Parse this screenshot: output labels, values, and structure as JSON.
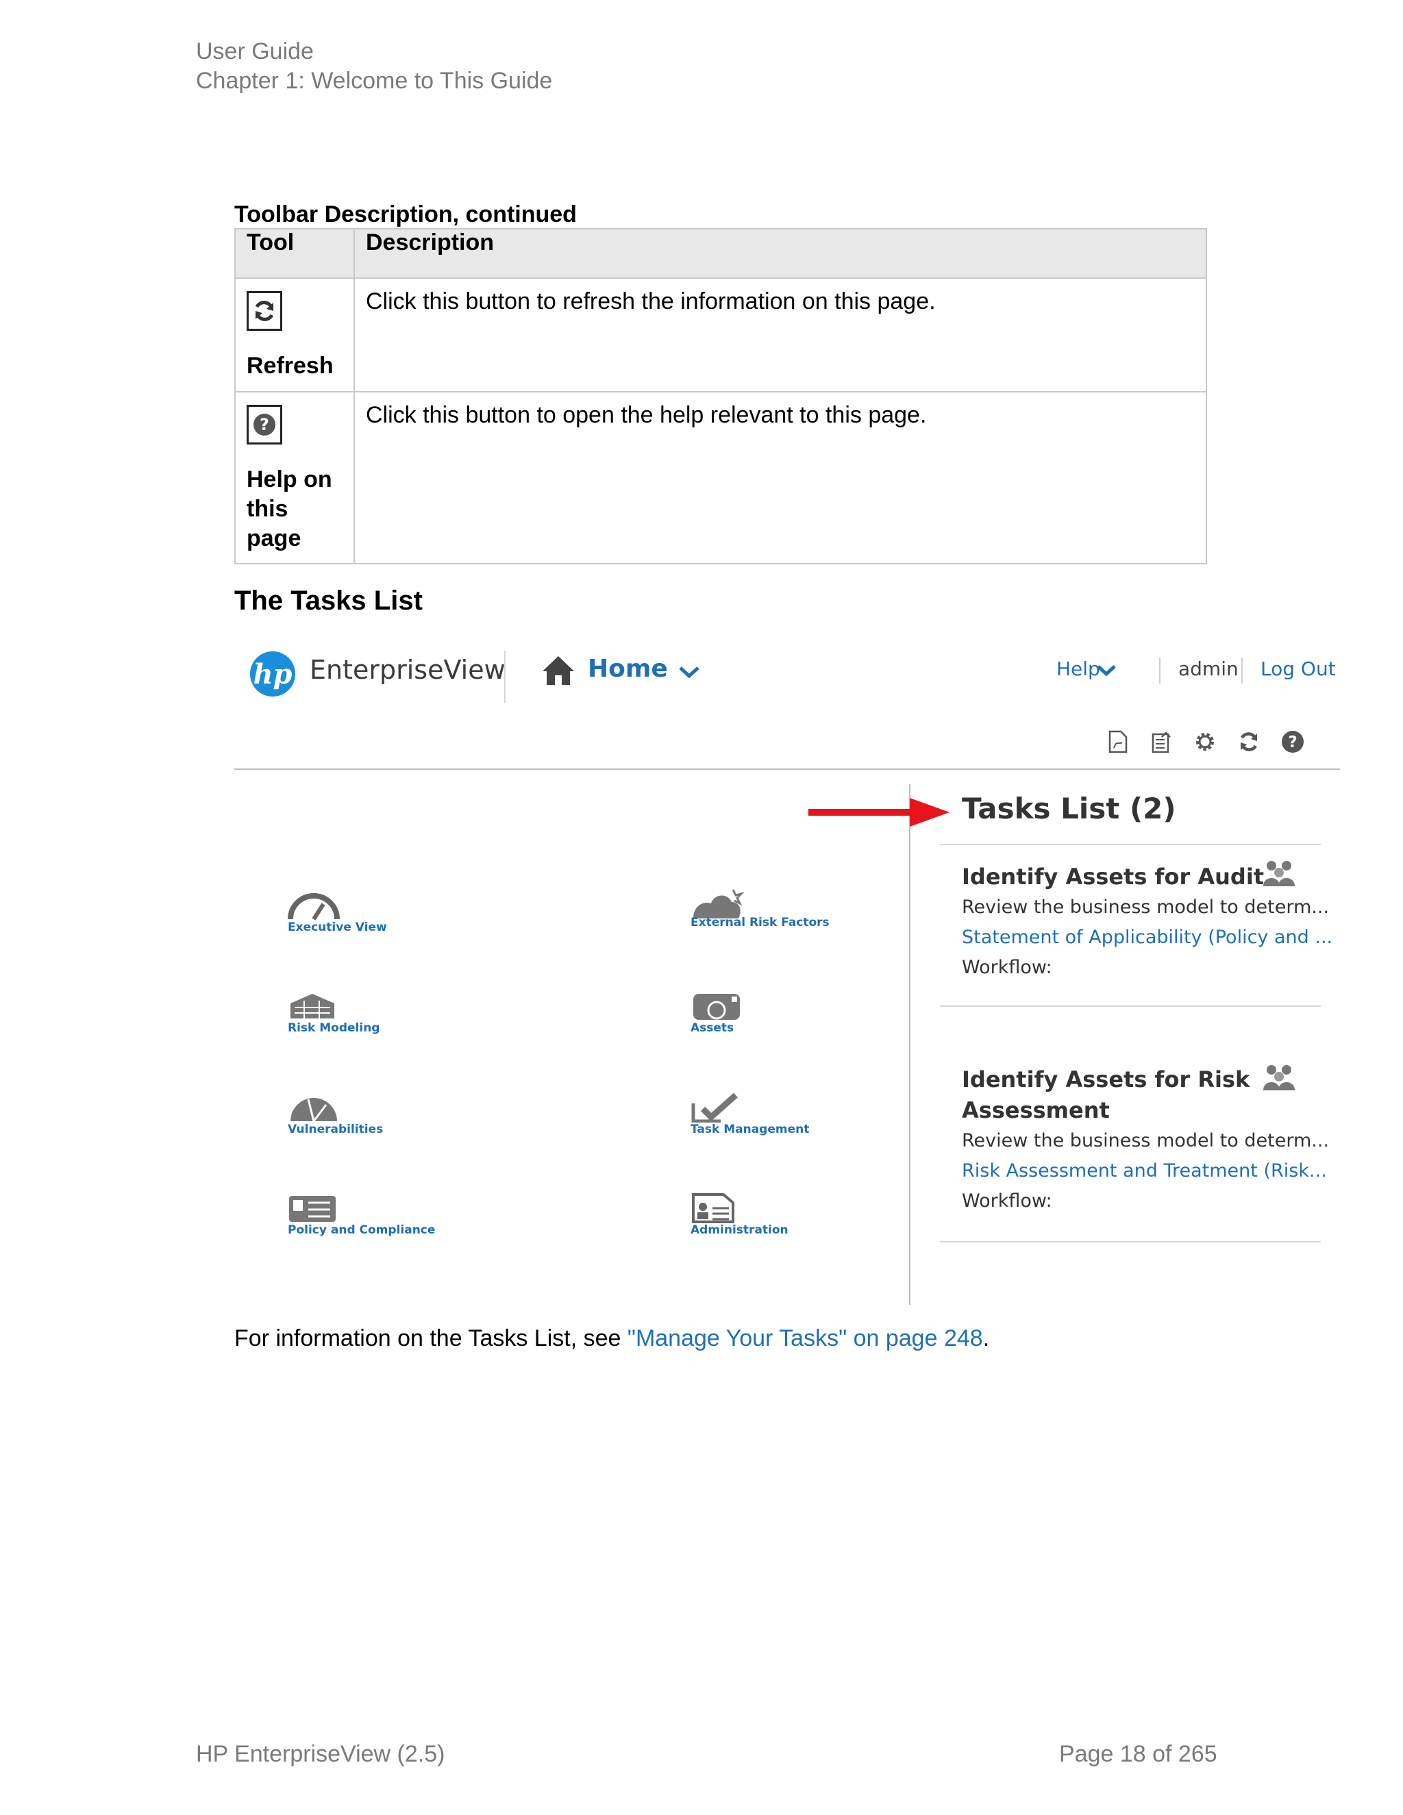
{
  "header": {
    "line1": "User Guide",
    "line2": "Chapter 1: Welcome to This Guide"
  },
  "table": {
    "caption": "Toolbar Description, continued",
    "col_tool": "Tool",
    "col_description": "Description",
    "rows": [
      {
        "tool": "Refresh",
        "description": "Click this button to refresh the information on this page."
      },
      {
        "tool": "Help on this page",
        "description": "Click this button to open the help relevant to this page."
      }
    ]
  },
  "section_title": "The Tasks List",
  "screenshot": {
    "brand": "EnterpriseView",
    "home": "Home",
    "help": "Help",
    "user": "admin",
    "logout": "Log Out",
    "tiles": [
      "Executive View",
      "External Risk Factors",
      "Risk Modeling",
      "Assets",
      "Vulnerabilities",
      "Task Management",
      "Policy and Compliance",
      "Administration"
    ],
    "tasks_title": "Tasks List (2)",
    "tasks": [
      {
        "title": "Identify Assets for Audit",
        "desc": "Review the business model to determ...",
        "link": "Statement of Applicability (Policy and ...",
        "workflow": "Workflow:"
      },
      {
        "title": "Identify Assets for Risk Assessment",
        "desc": "Review the business model to determ...",
        "link": "Risk Assessment and Treatment (Risk...",
        "workflow": "Workflow:"
      }
    ],
    "colors": {
      "link_blue": "#1e6fb8",
      "arrow_red": "#e8141b",
      "hp_blue": "#1a8ed8"
    }
  },
  "info": {
    "prefix": "For information on the Tasks List, see ",
    "link": "\"Manage Your Tasks\" on page 248",
    "suffix": "."
  },
  "footer": {
    "product": "HP EnterpriseView (2.5)",
    "page": "Page 18 of 265"
  }
}
